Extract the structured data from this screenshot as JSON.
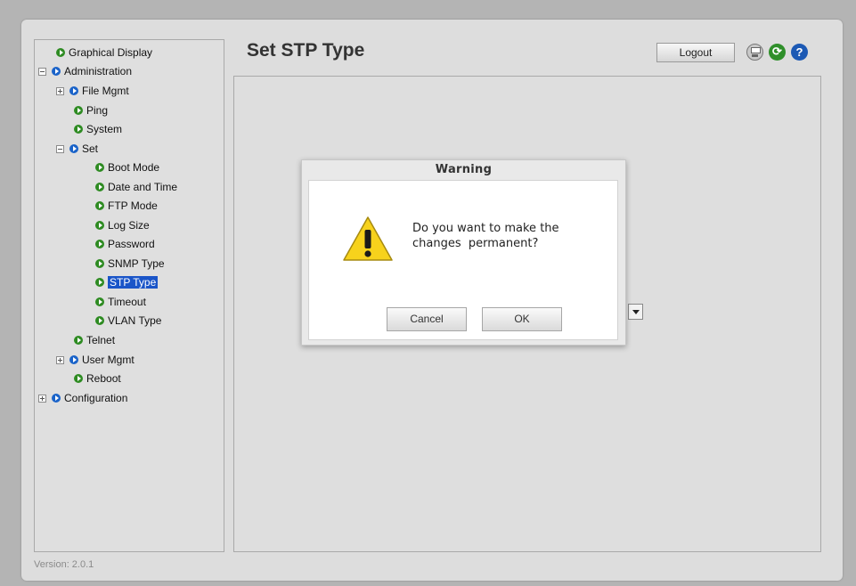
{
  "header": {
    "title": "Set STP Type",
    "logout_label": "Logout"
  },
  "toolbar": {
    "save_icon": "save-icon",
    "refresh_icon": "refresh-icon",
    "help_icon": "help-icon",
    "refresh_glyph": "⟳",
    "help_glyph": "?"
  },
  "sidebar": {
    "items": [
      {
        "label": "Graphical Display",
        "bullet": "green"
      },
      {
        "label": "Administration",
        "bullet": "blue",
        "expander": "minus"
      },
      {
        "label": "File Mgmt",
        "bullet": "blue",
        "expander": "plus"
      },
      {
        "label": "Ping",
        "bullet": "green"
      },
      {
        "label": "System",
        "bullet": "green"
      },
      {
        "label": "Set",
        "bullet": "blue",
        "expander": "minus"
      },
      {
        "label": "Boot Mode",
        "bullet": "green"
      },
      {
        "label": "Date and Time",
        "bullet": "green"
      },
      {
        "label": "FTP Mode",
        "bullet": "green"
      },
      {
        "label": "Log Size",
        "bullet": "green"
      },
      {
        "label": "Password",
        "bullet": "green"
      },
      {
        "label": "SNMP Type",
        "bullet": "green"
      },
      {
        "label": "STP Type",
        "bullet": "green",
        "selected": true
      },
      {
        "label": "Timeout",
        "bullet": "green"
      },
      {
        "label": "VLAN Type",
        "bullet": "green"
      },
      {
        "label": "Telnet",
        "bullet": "green"
      },
      {
        "label": "User Mgmt",
        "bullet": "blue",
        "expander": "plus"
      },
      {
        "label": "Reboot",
        "bullet": "green"
      },
      {
        "label": "Configuration",
        "bullet": "blue",
        "expander": "plus"
      }
    ]
  },
  "footer": {
    "version": "Version: 2.0.1"
  },
  "dialog": {
    "title": "Warning",
    "message_line1": "Do you want to make the",
    "message_line2": "changes  permanent?",
    "cancel_label": "Cancel",
    "ok_label": "OK"
  },
  "colors": {
    "selected": "#1a55c8",
    "green_bullet": "#2e8b22",
    "blue_bullet": "#1a63c9",
    "warning_yellow": "#f7d21c"
  }
}
